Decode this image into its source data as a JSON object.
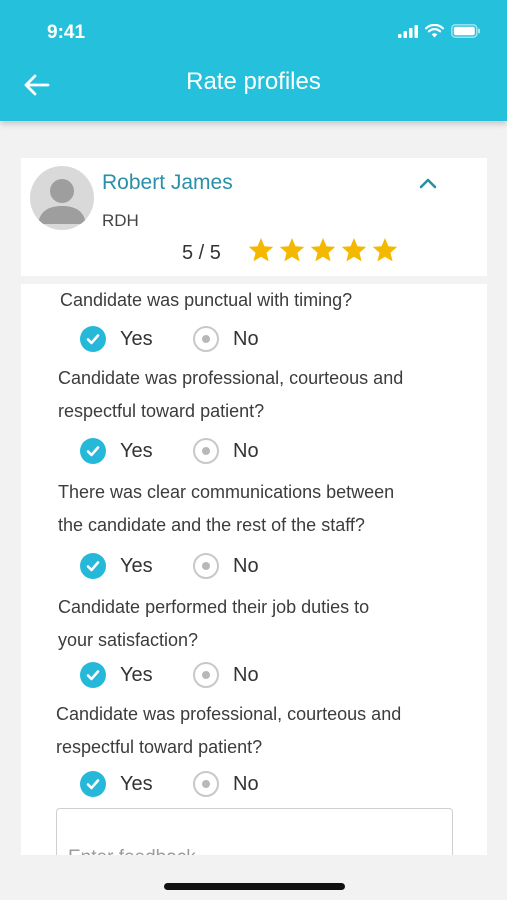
{
  "status_bar": {
    "time": "9:41"
  },
  "header": {
    "title": "Rate profiles"
  },
  "profile": {
    "name": "Robert James",
    "role": "RDH",
    "score": "5 / 5",
    "stars_filled": 5,
    "stars_total": 5
  },
  "questions": [
    {
      "lines": [
        "Candidate was punctual with timing?"
      ],
      "yes_label": "Yes",
      "no_label": "No",
      "selected": "yes"
    },
    {
      "lines": [
        "Candidate was professional, courteous and",
        "respectful toward patient?"
      ],
      "yes_label": "Yes",
      "no_label": "No",
      "selected": "yes"
    },
    {
      "lines": [
        "There was clear communications between",
        "the candidate and the rest of the staff?"
      ],
      "yes_label": "Yes",
      "no_label": "No",
      "selected": "yes"
    },
    {
      "lines": [
        "Candidate performed their job duties to",
        "your satisfaction?"
      ],
      "yes_label": "Yes",
      "no_label": "No",
      "selected": "yes"
    },
    {
      "lines": [
        "Candidate was professional, courteous and",
        "respectful toward patient?"
      ],
      "yes_label": "Yes",
      "no_label": "No",
      "selected": "yes"
    }
  ],
  "feedback": {
    "placeholder": "Enter feedback",
    "value": ""
  },
  "colors": {
    "accent": "#25c0dc",
    "star": "#f5b800",
    "name": "#2a8fa8"
  }
}
